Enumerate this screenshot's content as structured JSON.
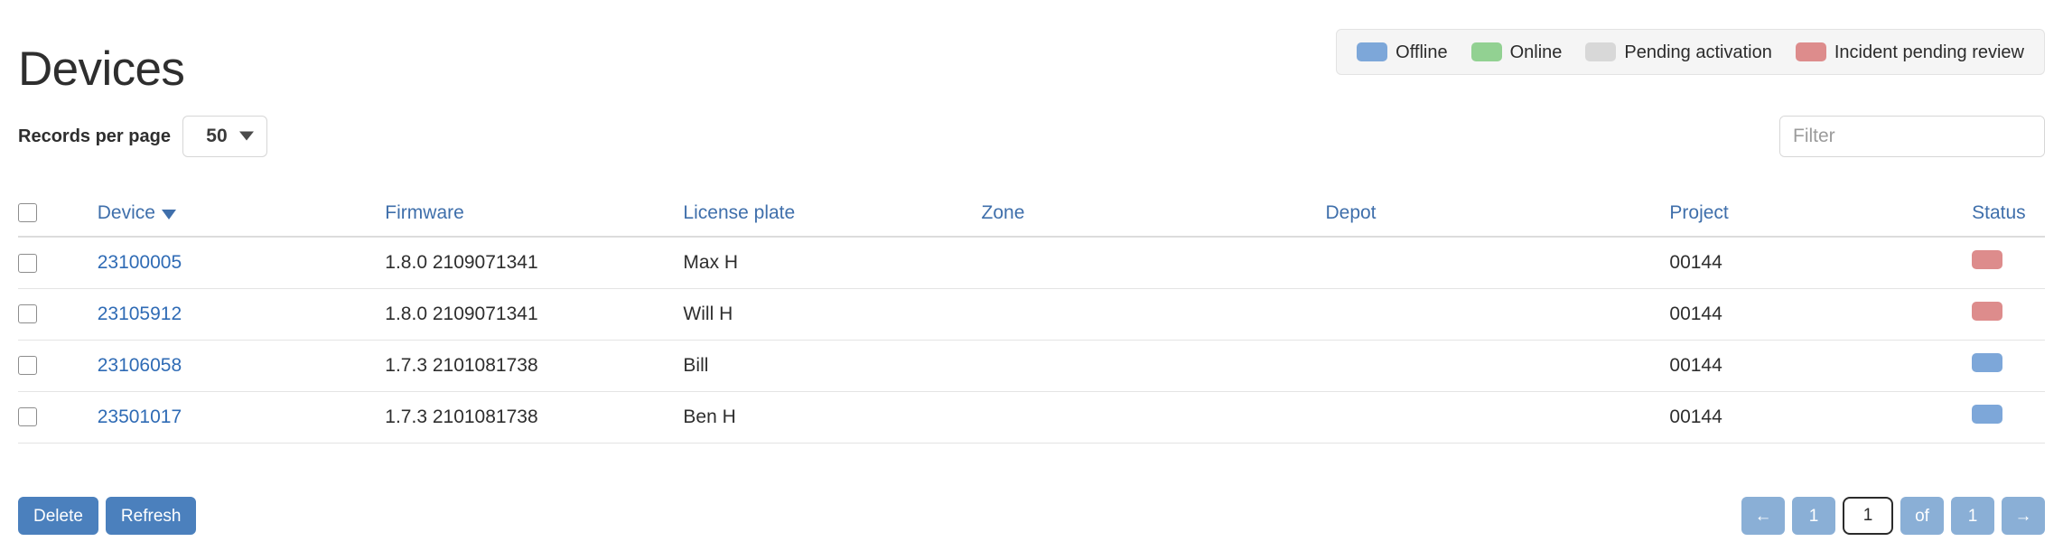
{
  "page_title": "Devices",
  "legend": {
    "items": [
      {
        "label": "Offline",
        "color": "#7da7d9"
      },
      {
        "label": "Online",
        "color": "#92d192"
      },
      {
        "label": "Pending activation",
        "color": "#d8d8d8"
      },
      {
        "label": "Incident pending review",
        "color": "#dd8c8c"
      }
    ]
  },
  "controls": {
    "records_label": "Records per page",
    "records_value": "50",
    "records_options": [
      "50"
    ],
    "filter_placeholder": "Filter",
    "filter_value": "",
    "filter_count": "4"
  },
  "table": {
    "columns": [
      {
        "key": "device",
        "label": "Device",
        "sorted": true,
        "sort_dir": "desc"
      },
      {
        "key": "firmware",
        "label": "Firmware"
      },
      {
        "key": "license_plate",
        "label": "License plate"
      },
      {
        "key": "zone",
        "label": "Zone"
      },
      {
        "key": "depot",
        "label": "Depot"
      },
      {
        "key": "project",
        "label": "Project"
      },
      {
        "key": "status",
        "label": "Status"
      }
    ],
    "rows": [
      {
        "checked": false,
        "device": "23100005",
        "firmware": "1.8.0 2109071341",
        "license_plate": "Max H",
        "zone": "",
        "depot": "",
        "project": "00144",
        "status_color": "#dd8c8c",
        "status_label": "Incident pending review"
      },
      {
        "checked": false,
        "device": "23105912",
        "firmware": "1.8.0 2109071341",
        "license_plate": "Will H",
        "zone": "",
        "depot": "",
        "project": "00144",
        "status_color": "#dd8c8c",
        "status_label": "Incident pending review"
      },
      {
        "checked": false,
        "device": "23106058",
        "firmware": "1.7.3 2101081738",
        "license_plate": "Bill",
        "zone": "",
        "depot": "",
        "project": "00144",
        "status_color": "#7da7d9",
        "status_label": "Offline"
      },
      {
        "checked": false,
        "device": "23501017",
        "firmware": "1.7.3 2101081738",
        "license_plate": "Ben H",
        "zone": "",
        "depot": "",
        "project": "00144",
        "status_color": "#7da7d9",
        "status_label": "Offline"
      }
    ]
  },
  "footer": {
    "delete_label": "Delete",
    "refresh_label": "Refresh",
    "pager": {
      "prev_label": "←",
      "first_page_label": "1",
      "current_page": "1",
      "of_label": "of",
      "total_pages": "1",
      "next_label": "→"
    }
  }
}
